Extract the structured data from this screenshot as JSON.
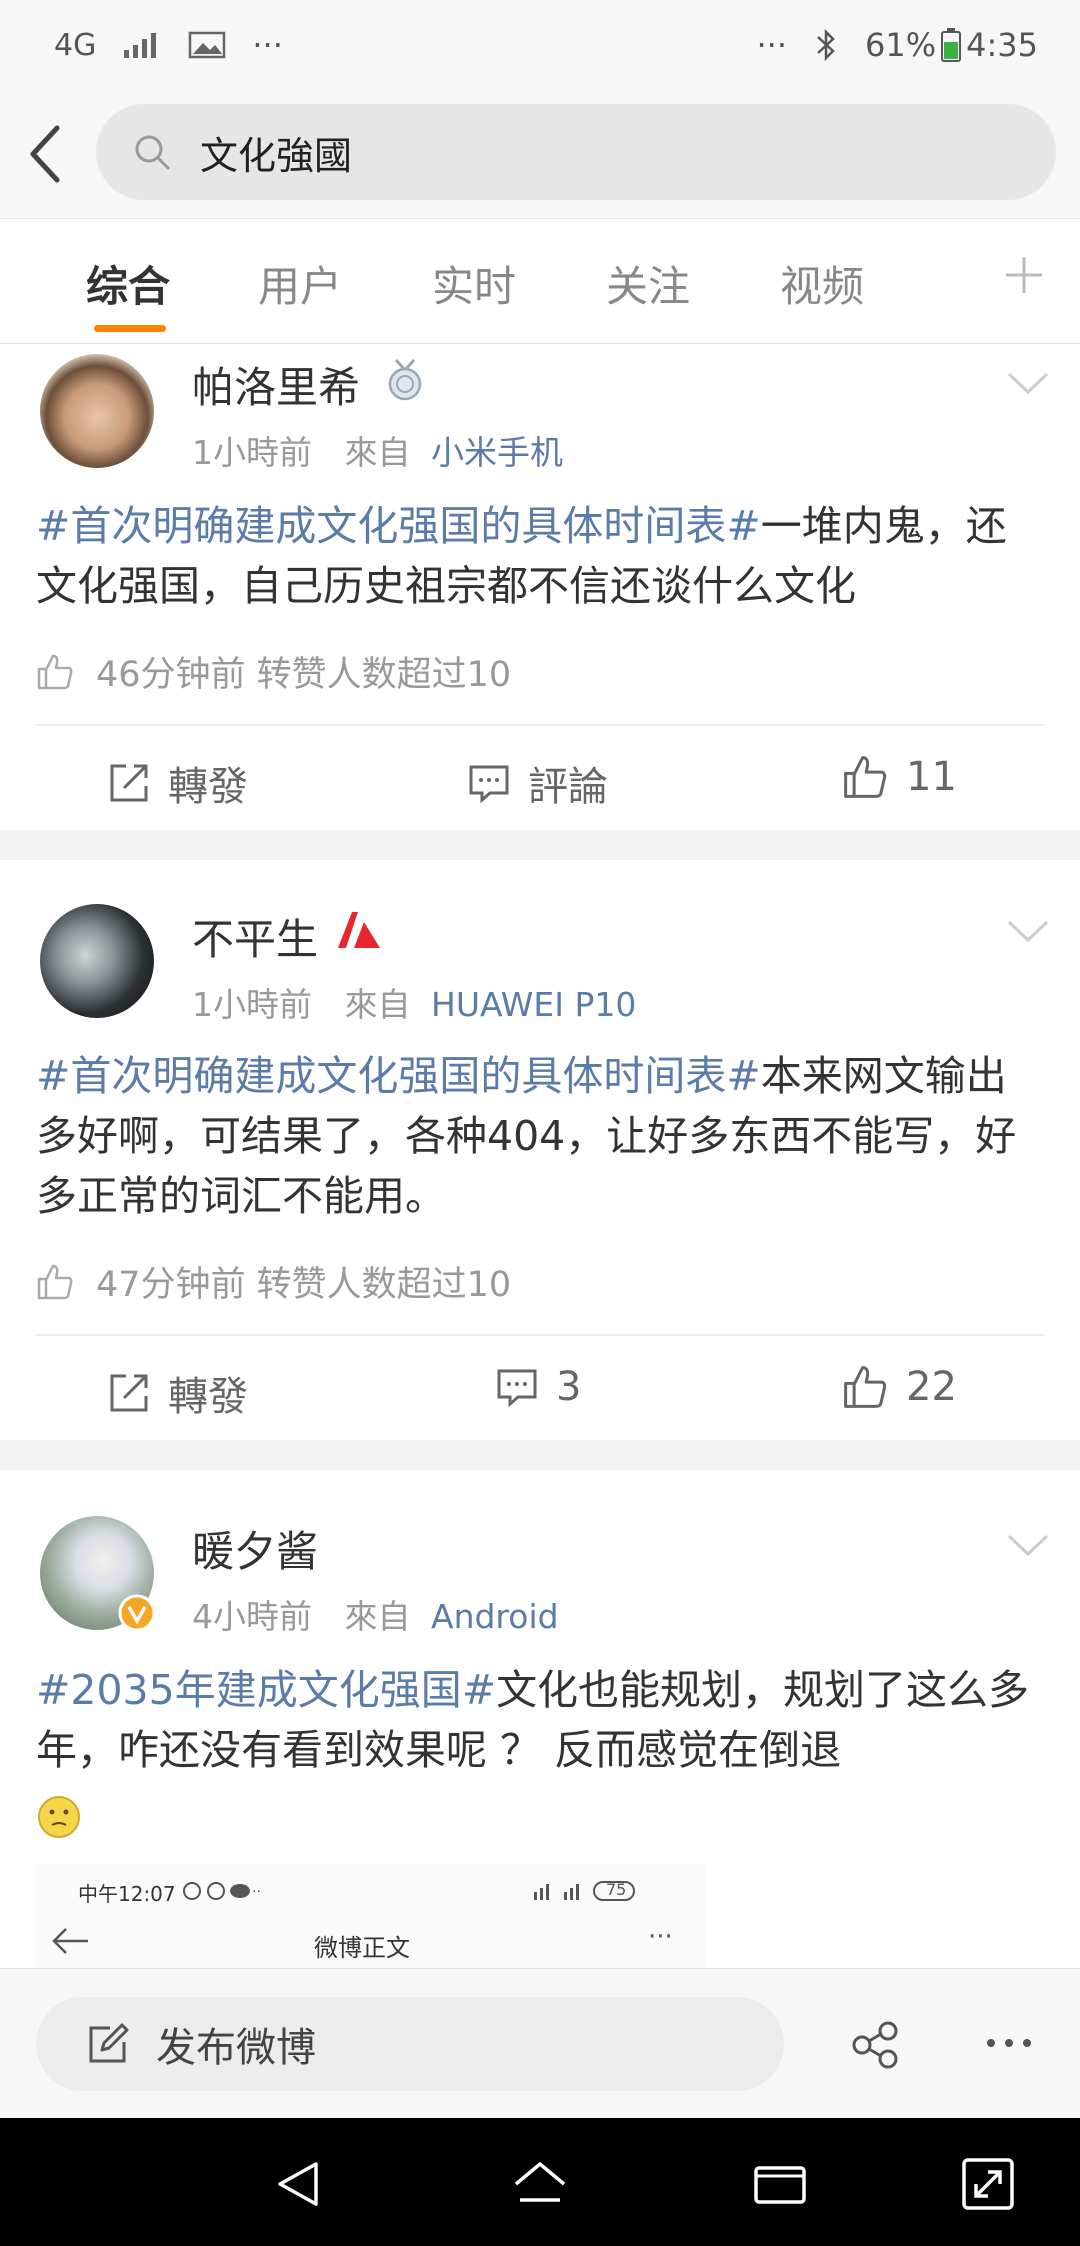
{
  "status_bar": {
    "network": "4G",
    "battery": "61%",
    "time": "4:35",
    "more": "···"
  },
  "search": {
    "query": "文化強國"
  },
  "tabs": [
    {
      "label": "综合",
      "active": true
    },
    {
      "label": "用户",
      "active": false
    },
    {
      "label": "实时",
      "active": false
    },
    {
      "label": "关注",
      "active": false
    },
    {
      "label": "视频",
      "active": false
    }
  ],
  "accent_color": "#ff8200",
  "link_color": "#5b7ca8",
  "posts": [
    {
      "username": "帕洛里希",
      "time": "1小時前",
      "from_label": "來自",
      "source": "小米手机",
      "hashtag": "#首次明确建成文化强国的具体时间表#",
      "text": "一堆内鬼，还文化强国，自己历史祖宗都不信还谈什么文化",
      "liked_info": "46分钟前 转赞人数超过10",
      "repost_label": "轉發",
      "comment_label": "評論",
      "like_count": "11"
    },
    {
      "username": "不平生",
      "time": "1小時前",
      "from_label": "來自",
      "source": "HUAWEI P10",
      "hashtag": "#首次明确建成文化强国的具体时间表#",
      "text": "本来网文输出多好啊，可结果了，各种404，让好多东西不能写，好多正常的词汇不能用。",
      "liked_info": "47分钟前 转赞人数超过10",
      "repost_label": "轉發",
      "comment_label": "3",
      "like_count": "22"
    },
    {
      "username": "暖夕酱",
      "time": "4小時前",
      "from_label": "來自",
      "source": "Android",
      "hashtag": "#2035年建成文化强国#",
      "text": "文化也能规划，规划了这么多年，咋还没有看到效果呢 ？ 反而感觉在倒退"
    }
  ],
  "embedded_screenshot": {
    "time": "中午12:07",
    "title": "微博正文",
    "battery": "75"
  },
  "bottom": {
    "compose_label": "发布微博"
  }
}
